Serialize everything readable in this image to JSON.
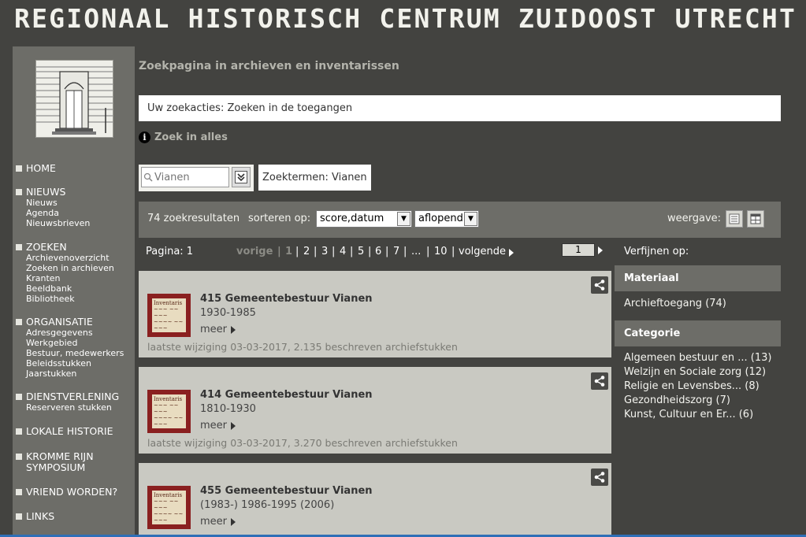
{
  "site": {
    "title": "REGIONAAL HISTORISCH CENTRUM ZUIDOOST UTRECHT"
  },
  "nav": {
    "home": {
      "label": "HOME"
    },
    "nieuws": {
      "label": "NIEUWS",
      "subs": [
        "Nieuws",
        "Agenda",
        "Nieuwsbrieven"
      ]
    },
    "zoeken": {
      "label": "ZOEKEN",
      "subs": [
        "Archievenoverzicht",
        "Zoeken in archieven",
        "Kranten",
        "Beeldbank",
        "Bibliotheek"
      ]
    },
    "organisatie": {
      "label": "ORGANISATIE",
      "subs": [
        "Adresgegevens",
        "Werkgebied",
        "Bestuur, medewerkers",
        "Beleidsstukken",
        "Jaarstukken"
      ]
    },
    "dienstverlening": {
      "label": "DIENSTVERLENING",
      "subs": [
        "Reserveren stukken"
      ]
    },
    "lokale": {
      "label": "LOKALE HISTORIE"
    },
    "kromme": {
      "label": "KROMME RIJN SYMPOSIUM"
    },
    "vriend": {
      "label": "VRIEND WORDEN?"
    },
    "links": {
      "label": "LINKS"
    }
  },
  "main": {
    "page_title": "Zoekpagina in archieven en inventarissen",
    "actions": "Uw zoekacties: Zoeken in de toegangen",
    "zoek_alles": "Zoek in alles",
    "search_placeholder": "Vianen",
    "zoektermen": "Zoektermen: Vianen"
  },
  "results": {
    "count": "74 zoekresultaten",
    "sort_label": "sorteren op:",
    "sort_value": "score,datum",
    "order_value": "aflopend",
    "view_label": "weergave:"
  },
  "pager": {
    "label": "Pagina: 1",
    "prev": "vorige",
    "pages": [
      "1",
      "2",
      "3",
      "4",
      "5",
      "6",
      "7",
      "...",
      "10"
    ],
    "next": "volgende",
    "current": "1"
  },
  "cards": [
    {
      "title": "415 Gemeentebestuur Vianen",
      "years": "1930-1985",
      "meer": "meer",
      "modified": "laatste wijziging 03-03-2017,  2.135 beschreven archiefstukken"
    },
    {
      "title": "414 Gemeentebestuur Vianen",
      "years": "1810-1930",
      "meer": "meer",
      "modified": "laatste wijziging 03-03-2017,  3.270 beschreven archiefstukken"
    },
    {
      "title": "455 Gemeentebestuur Vianen",
      "years": "(1983-) 1986-1995 (2006)",
      "meer": "meer",
      "modified": ""
    }
  ],
  "refine": {
    "label": "Verfijnen op:",
    "materiaal": {
      "heading": "Materiaal",
      "items": [
        "Archieftoegang (74)"
      ]
    },
    "categorie": {
      "heading": "Categorie",
      "items": [
        "Algemeen bestuur en ... (13)",
        "Welzijn en Sociale zorg (12)",
        "Religie en Levensbes... (8)",
        "Gezondheidszorg (7)",
        "Kunst, Cultuur en Er... (6)"
      ]
    }
  },
  "colors": {
    "background": "#434340",
    "panel": "#6d6d68",
    "card": "#c9c9c2",
    "thumb": "#8a2020"
  }
}
